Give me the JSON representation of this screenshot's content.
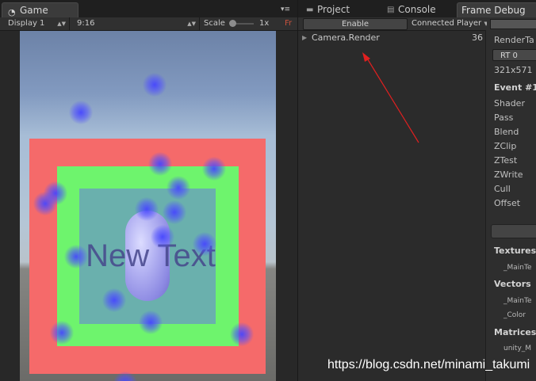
{
  "game": {
    "tab_label": "Game",
    "tab_icon": "pacman-icon",
    "menu_icon": "▾≡",
    "toolbar": {
      "display": "Display 1",
      "aspect": "9:16",
      "scale_label": "Scale",
      "scale_value": "1x",
      "maximize_cut": "Fr"
    },
    "scene_text": "New Text",
    "colors": {
      "outer_rect": "#f56a6a",
      "middle_rect": "#6ef46d",
      "inner_rect": "#6ab0ad",
      "sprite_blobs": "#4646ff"
    }
  },
  "tabs": {
    "project": "Project",
    "console": "Console",
    "frame_debug": "Frame Debug"
  },
  "frame_debugger": {
    "enable_label": "Enable",
    "connected_player": "Connected Player",
    "event": {
      "name": "Camera.Render",
      "count": "36"
    }
  },
  "inspector": {
    "render_target_label": "RenderTa",
    "rt_select": "RT 0",
    "resolution": "321x571",
    "event_header": "Event #1",
    "props": [
      "Shader",
      "Pass",
      "Blend",
      "ZClip",
      "ZTest",
      "ZWrite",
      "Cull",
      "Offset"
    ],
    "textures_header": "Textures",
    "texture_item": "_MainTe",
    "vectors_header": "Vectors",
    "vector_items": [
      "_MainTe",
      "_Color"
    ],
    "matrices_header": "Matrices",
    "matrix_item": "unity_M"
  },
  "watermark": "https://blog.csdn.net/minami_takumi"
}
